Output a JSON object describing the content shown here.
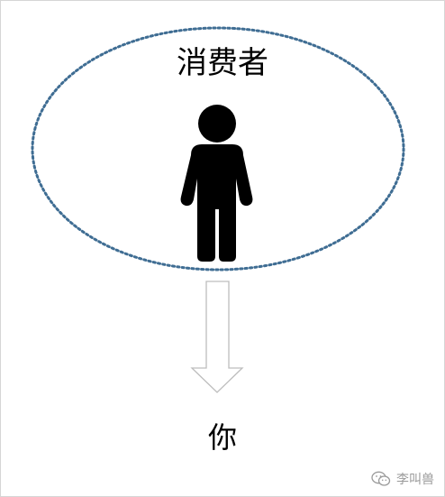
{
  "diagram": {
    "consumer_label": "消费者",
    "target_label": "你"
  },
  "watermark": {
    "text": "李叫兽",
    "icon": "wechat-icon"
  },
  "colors": {
    "ellipse_dots": "#3f6d93",
    "figure": "#000000",
    "arrow_stroke": "#bdbdbd",
    "frame": "#d6d6d6"
  }
}
